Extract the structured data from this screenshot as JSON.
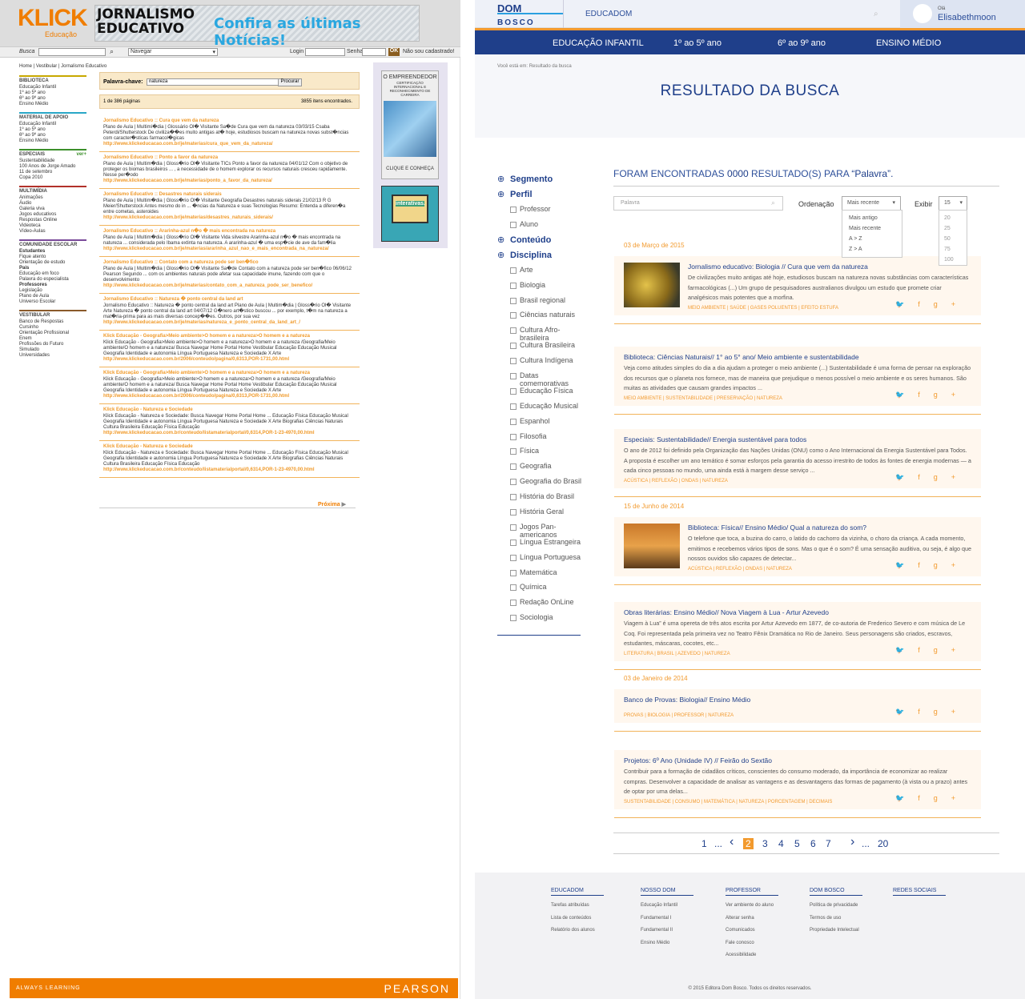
{
  "left": {
    "logo": "KLICK",
    "logo_sub": "Educação",
    "banner": {
      "logo_line1": "JORNALISMO",
      "logo_line2": "EDUCATIVO",
      "text": "Confira as últimas Notícias!"
    },
    "bar": {
      "busca": "Busca",
      "navegar": "Navegar",
      "login": "Login",
      "senha": "Senha",
      "ok": "OK",
      "nao_cadastrado": "Não sou cadastrado!"
    },
    "breadcrumb": "Home | Vestibular | Jornalismo Educativo",
    "nav": [
      {
        "title": "BIBLIOTECA",
        "color": "#c8a800",
        "items": [
          "Educação Infantil",
          "1º ao 5º ano",
          "6º ao 9º ano",
          "Ensino Médio"
        ]
      },
      {
        "title": "MATERIAL DE APOIO",
        "color": "#2aa7c7",
        "items": [
          "Educação Infantil",
          "1º ao 5º ano",
          "6º ao 9º ano",
          "Ensino Médio"
        ]
      },
      {
        "title": "ESPECIAIS",
        "extra": "ver+",
        "color": "#3b8f2a",
        "items": [
          "Sustentabilidade",
          "100 Anos de Jorge Amado",
          "11 de setembro",
          "Copa 2010"
        ]
      },
      {
        "title": "MULTIMÍDIA",
        "color": "#b2312a",
        "items": [
          "Animações",
          "Áudio",
          "Galeria viva",
          "Jogos educativos",
          "Respostas Online",
          "Videoteca",
          "Vídeo-Aulas"
        ]
      },
      {
        "title": "COMUNIDADE ESCOLAR",
        "color": "#7a4a9a",
        "groups": [
          {
            "sub": "Estudantes",
            "items": [
              "Fique atento",
              "Orientação de estudo"
            ]
          },
          {
            "sub": "Pais",
            "items": [
              "Educação em foco",
              "Palavra do especialista"
            ]
          },
          {
            "sub": "Professores",
            "items": [
              "Legislação",
              "Plano de Aula",
              "Universo Escolar"
            ]
          }
        ]
      },
      {
        "title": "VESTIBULAR",
        "color": "#8a5a2a",
        "items": [
          "Banco de Respostas",
          "Cursinho",
          "Orientação Profissional",
          "Enem",
          "Profissões do Futuro",
          "Simulado",
          "Universidades"
        ]
      }
    ],
    "search": {
      "label": "Palavra-chave:",
      "value": "natureza",
      "button": "Procurar"
    },
    "pages": "1 de 386 páginas",
    "found": "3855 itens encontrados.",
    "results": [
      {
        "title": "Jornalismo Educativo :: Cura que vem da natureza",
        "desc": "Plano de Aula | Multimí�dia | Glossário Ol� Visitante Sa�de Cura que vem da natureza 03/03/15 Csaba Peterdi/Shutterstock De civiliza��es muito antigas at� hoje, estudiosos buscam na natureza novas subst�ncias com caracter�sticas farmacol�gicas",
        "url": "http://www.klickeducacao.com.br/je/materias/cura_que_vem_da_natureza/"
      },
      {
        "title": "Jornalismo Educativo :: Ponto a favor da natureza",
        "desc": "Plano de Aula | Multim�dia | Gloss�rio Ol� Visitante TICs Ponto a favor da natureza 04/01/12 Com o objetivo de proteger os biomas brasileiros ... , a necessidade de o homem explorar os recursos naturais cresceu rapidamente. Nesse per�odo",
        "url": "http://www.klickeducacao.com.br/je/materias/ponto_a_favor_da_natureza/"
      },
      {
        "title": "Jornalismo Educativo :: Desastres naturais siderais",
        "desc": "Plano de Aula | Multim�dia | Gloss�rio Ol� Visitante Geografia Desastres naturais siderais 21/02/13 R G Meier/Shutterstock Antes mesmo do in ... �ncias da Natureza e suas Tecnologias Resumo: Entenda a diferen�a entre cometas, asteroides",
        "url": "http://www.klickeducacao.com.br/je/materias/desastres_naturais_siderais/"
      },
      {
        "title": "Jornalismo Educativo :: Ararinha-azul n�o � mais encontrada na natureza",
        "desc": "Plano de Aula | Multim�dia | Gloss�rio Ol� Visitante Vida silvestre Ararinha-azul n�o � mais encontrada na natureza ... considerada pelo Ibama extinta na natureza. A ararinha-azul � uma esp�cie de ave da fam�lia",
        "url": "http://www.klickeducacao.com.br/je/materias/ararinha_azul_nao_e_mais_encontrada_na_natureza/"
      },
      {
        "title": "Jornalismo Educativo :: Contato com a natureza pode ser ben�fico",
        "desc": "Plano de Aula | Multim�dia | Gloss�rio Ol� Visitante Sa�de Contato com a natureza pode ser ben�fico 06/06/12 Pearson Segundo ... com os ambientes naturais pode afetar sua capacidade imune, fazendo com que o desenvolvimento",
        "url": "http://www.klickeducacao.com.br/je/materias/contato_com_a_natureza_pode_ser_benefico/"
      },
      {
        "title": "Jornalismo Educativo :: Natureza � ponto central da land art",
        "desc": "Jornalismo Educativo :: Natureza � ponto central da land art Plano de Aula | Multim�dia | Gloss�rio Ol� Visitante Arte Natureza � ponto central da land art 04/07/12 G�nero art�stico buscou ... por exemplo, t�m na natureza a mat�ria-prima para as mais diversas concep��es. Outros, por sua vez",
        "url": "http://www.klickeducacao.com.br/je/materias/natureza_e_ponto_central_da_land_art_/"
      },
      {
        "title": "Klick Educação - Geografia>Meio ambiente>O homem e a natureza>O homem e a natureza",
        "desc": "Klick Educação - Geografia>Meio ambiente>O homem e a natureza>O homem e a natureza /Geografia/Meio ambiente/O homem e a natureza/ Busca Navegar Home Portal Home Vestibular Educação Educação Musical Geografia Identidade e autonomia Língua Portuguesa Natureza e Sociedade X Arte",
        "url": "http://www.klickeducacao.com.br/2006/conteudo/pagina/0,6313,POR-1731,00.html"
      },
      {
        "title": "Klick Educação - Geografia>Meio ambiente>O homem e a natureza>O homem e a natureza",
        "desc": "Klick Educação - Geografia>Meio ambiente>O homem e a natureza>O homem e a natureza /Geografia/Meio ambiente/O homem e a natureza/ Busca Navegar Home Portal Home Vestibular Educação Educação Musical Geografia Identidade e autonomia Língua Portuguesa Natureza e Sociedade X Arte",
        "url": "http://www.klickeducacao.com.br/2006/conteudo/pagina/0,6313,POR-1731,00.html"
      },
      {
        "title": "Klick Educação - Natureza e Sociedade",
        "desc": "Klick Educação - Natureza e Sociedade: Busca Navegar Home Portal Home ... Educação Física Educação Musical Geografia Identidade e autonomia Língua Portuguesa Natureza e Sociedade X Arte Biografias Ciências Naturais Cultura Brasileira Educação Física Educação",
        "url": "http://www.klickeducacao.com.br/conteudo/listamaterialportal/0,6314,POR-1-23-4970,00.html"
      },
      {
        "title": "Klick Educação - Natureza e Sociedade",
        "desc": "Klick Educação - Natureza e Sociedade: Busca Navegar Home Portal Home ... Educação Física Educação Musical Geografia Identidade e autonomia Língua Portuguesa Natureza e Sociedade X Arte Biografias Ciências Naturais Cultura Brasileira Educação Física Educação",
        "url": "http://www.klickeducacao.com.br/conteudo/listamaterialportal/0,6314,POR-1-23-4970,00.html"
      }
    ],
    "next": "Próxima",
    "ad1": {
      "title": "O EMPREENDEDOR",
      "sub": "CERTIFICAÇÃO INTERNACIONAL E RECONHECIMENTO DE CARREIRA",
      "cta": "CLIQUE E CONHEÇA"
    },
    "ad2": {
      "text": "interativas."
    },
    "footer": {
      "left": "ALWAYS LEARNING",
      "right": "PEARSON"
    }
  },
  "right": {
    "logo_top": "DOM",
    "logo_bottom": "BOSCO",
    "header_link": "EDUCADOM",
    "ola": "Olá",
    "user": "Elisabethmoon",
    "nav": [
      "EDUCAÇÃO INFANTIL",
      "1º ao 5º ano",
      "6º ao 9º ano",
      "ENSINO MÉDIO"
    ],
    "breadcrumb": "Você está em: Resultado da busca",
    "title": "RESULTADO DA BUSCA",
    "side": {
      "segmento": "Segmento",
      "perfil": "Perfil",
      "perfil_items": [
        "Professor",
        "Aluno"
      ],
      "conteudo": "Conteúdo",
      "disciplina": "Disciplina",
      "disciplinas": [
        "Arte",
        "Biologia",
        "Brasil regional",
        "Ciências naturais",
        "Cultura Afro-brasileira",
        "Cultura Brasileira",
        "Cultura Indígena",
        "Datas comemorativas",
        "Educação Física",
        "Educação Musical",
        "Espanhol",
        "Filosofia",
        "Física",
        "Geografia",
        "Geografia do Brasil",
        "História do Brasil",
        "História Geral",
        "Jogos Pan-americanos",
        "Língua Estrangeira",
        "Língua Portuguesa",
        "Matemática",
        "Química",
        "Redação OnLine",
        "Sociologia"
      ]
    },
    "found": {
      "pre": "FORAM ENCONTRADAS ",
      "num": "0000",
      "post": " RESULTADO(S) PARA ",
      "word": "“Palavra”."
    },
    "filter": {
      "placeholder": "Palavra",
      "ordenacao": "Ordenação",
      "selected": "Mais recente",
      "exibir": "Exibir",
      "count": "15",
      "order_options": [
        "Mais antigo",
        "Mais recente",
        "A > Z",
        "Z > A"
      ],
      "count_options": [
        "20",
        "25",
        "50",
        "75",
        "100"
      ]
    },
    "results": [
      {
        "date": "03 de Março de 2015",
        "title": "Jornalismo educativo: Biologia // Cura que vem da natureza",
        "desc": "De civilizações muito antigas até hoje, estudiosos buscam na natureza novas substâncias com características farmacológicas (...) Um grupo de pesquisadores australianos divulgou um estudo que promete criar analgésicos mais potentes que a morfina.",
        "tags": "MEIO AMBIENTE  |  SAÚDE  |  GASES POLUENTES  |  EFEITO ESTUFA"
      },
      {
        "date": "",
        "title": "Biblioteca: Ciências Naturais// 1° ao 5° ano/ Meio ambiente e sustentabilidade",
        "desc": "Veja como atitudes simples do dia a dia ajudam a proteger o meio ambiente (...) Sustentabilidade é uma forma de pensar na exploração dos recursos que o planeta nos fornece, mas de maneira que prejudique o menos possível o meio ambiente e os seres humanos.  São muitas as atividades que causam grandes impactos ...",
        "tags": "MEIO AMBIENTE  |  SUSTENTABILIDADE  |  PRESERVAÇÃO  |  NATUREZA"
      },
      {
        "date": "",
        "title": "Especiais: Sustentabilidade// Energia sustentável para todos",
        "desc": "O ano de 2012 foi definido pela Organização das Nações Unidas (ONU) como o Ano Internacional da Energia Sustentável para Todos. A proposta é escolher um ano temático é somar esforços pela garantia do acesso irrestrito de todos às fontes de energia modernas — a cada cinco pessoas no mundo, uma ainda está à margem desse serviço ...",
        "tags": "ACÚSTICA  |  REFLEXÃO  |  ONDAS  |  NATUREZA"
      },
      {
        "date": "15 de Junho de 2014",
        "title": "Biblioteca: Física// Ensino Médio/ Qual a natureza do som?",
        "desc": "O telefone que toca, a buzina do carro, o latido do cachorro da vizinha, o choro da criança. A cada momento, emitimos e recebemos vários tipos de sons. Mas o que é o som? É uma sensação auditiva, ou seja, é algo que nossos ouvidos são capazes de detectar...",
        "tags": "ACÚSTICA  |  REFLEXÃO  |  ONDAS  |  NATUREZA"
      },
      {
        "date": "",
        "title": "Obras literárias: Ensino Médio// Nova Viagem à Lua - Artur Azevedo",
        "desc": "Viagem à Lua” é uma opereta de três atos escrita por Artur Azevedo em 1877, de co-autoria de Frederico Severo e com música de Le Coq. Foi representada pela primeira vez no Teatro Fênix Dramática no Rio de Janeiro. Seus personagens são criados, escravos, estudantes, máscaras, cocotes, etc...",
        "tags": "LITERATURA  |  BRASIL  |  AZEVEDO  |  NATUREZA"
      },
      {
        "date": "03 de Janeiro de 2014",
        "title": "Banco de Provas: Biologia// Ensino Médio",
        "desc": "",
        "tags": "PROVAS  |  BIOLOGIA  |  PROFESSOR  |  NATUREZA"
      },
      {
        "date": "",
        "title": "Projetos: 6º Ano (Unidade IV) // Feirão do Sextão",
        "desc": "Contribuir para a formação de cidadãos críticos, conscientes do consumo moderado, da importância de economizar ao realizar compras. Desenvolver a capacidade de analisar as vantagens e as desvantagens das formas de pagamento (à vista ou a prazo) antes de optar por uma delas...",
        "tags": "SUSTENTABILIDADE |  CONSUMO  |  MATEMÁTICA  |  NATUREZA  |  PORCENTAGEM  |  DECIMAIS"
      }
    ],
    "pagination": [
      "1",
      "...",
      "2",
      "3",
      "4",
      "5",
      "6",
      "7",
      "...",
      "20"
    ],
    "current_page": "2",
    "footer": [
      {
        "h": "EDUCADOM",
        "items": [
          "Tarefas atribuídas",
          "Lista de conteúdos",
          "Relatório dos alunos"
        ]
      },
      {
        "h": "NOSSO DOM",
        "items": [
          "Educação Infantil",
          "Fundamental I",
          "Fundamental II",
          "Ensino Médio"
        ]
      },
      {
        "h": "PROFESSOR",
        "items": [
          "Ver ambiente do aluno",
          "Alterar senha",
          "Comunicados",
          "Fale conosco",
          "Acessibilidade"
        ]
      },
      {
        "h": "DOM BOSCO",
        "items": [
          "Política de privacidade",
          "Termos de uso",
          "Propriedade Intelectual"
        ]
      },
      {
        "h": "REDES SOCIAIS",
        "items": []
      }
    ],
    "copyright": "© 2015 Editora Dom Bosco. Todos os direitos reservados."
  }
}
